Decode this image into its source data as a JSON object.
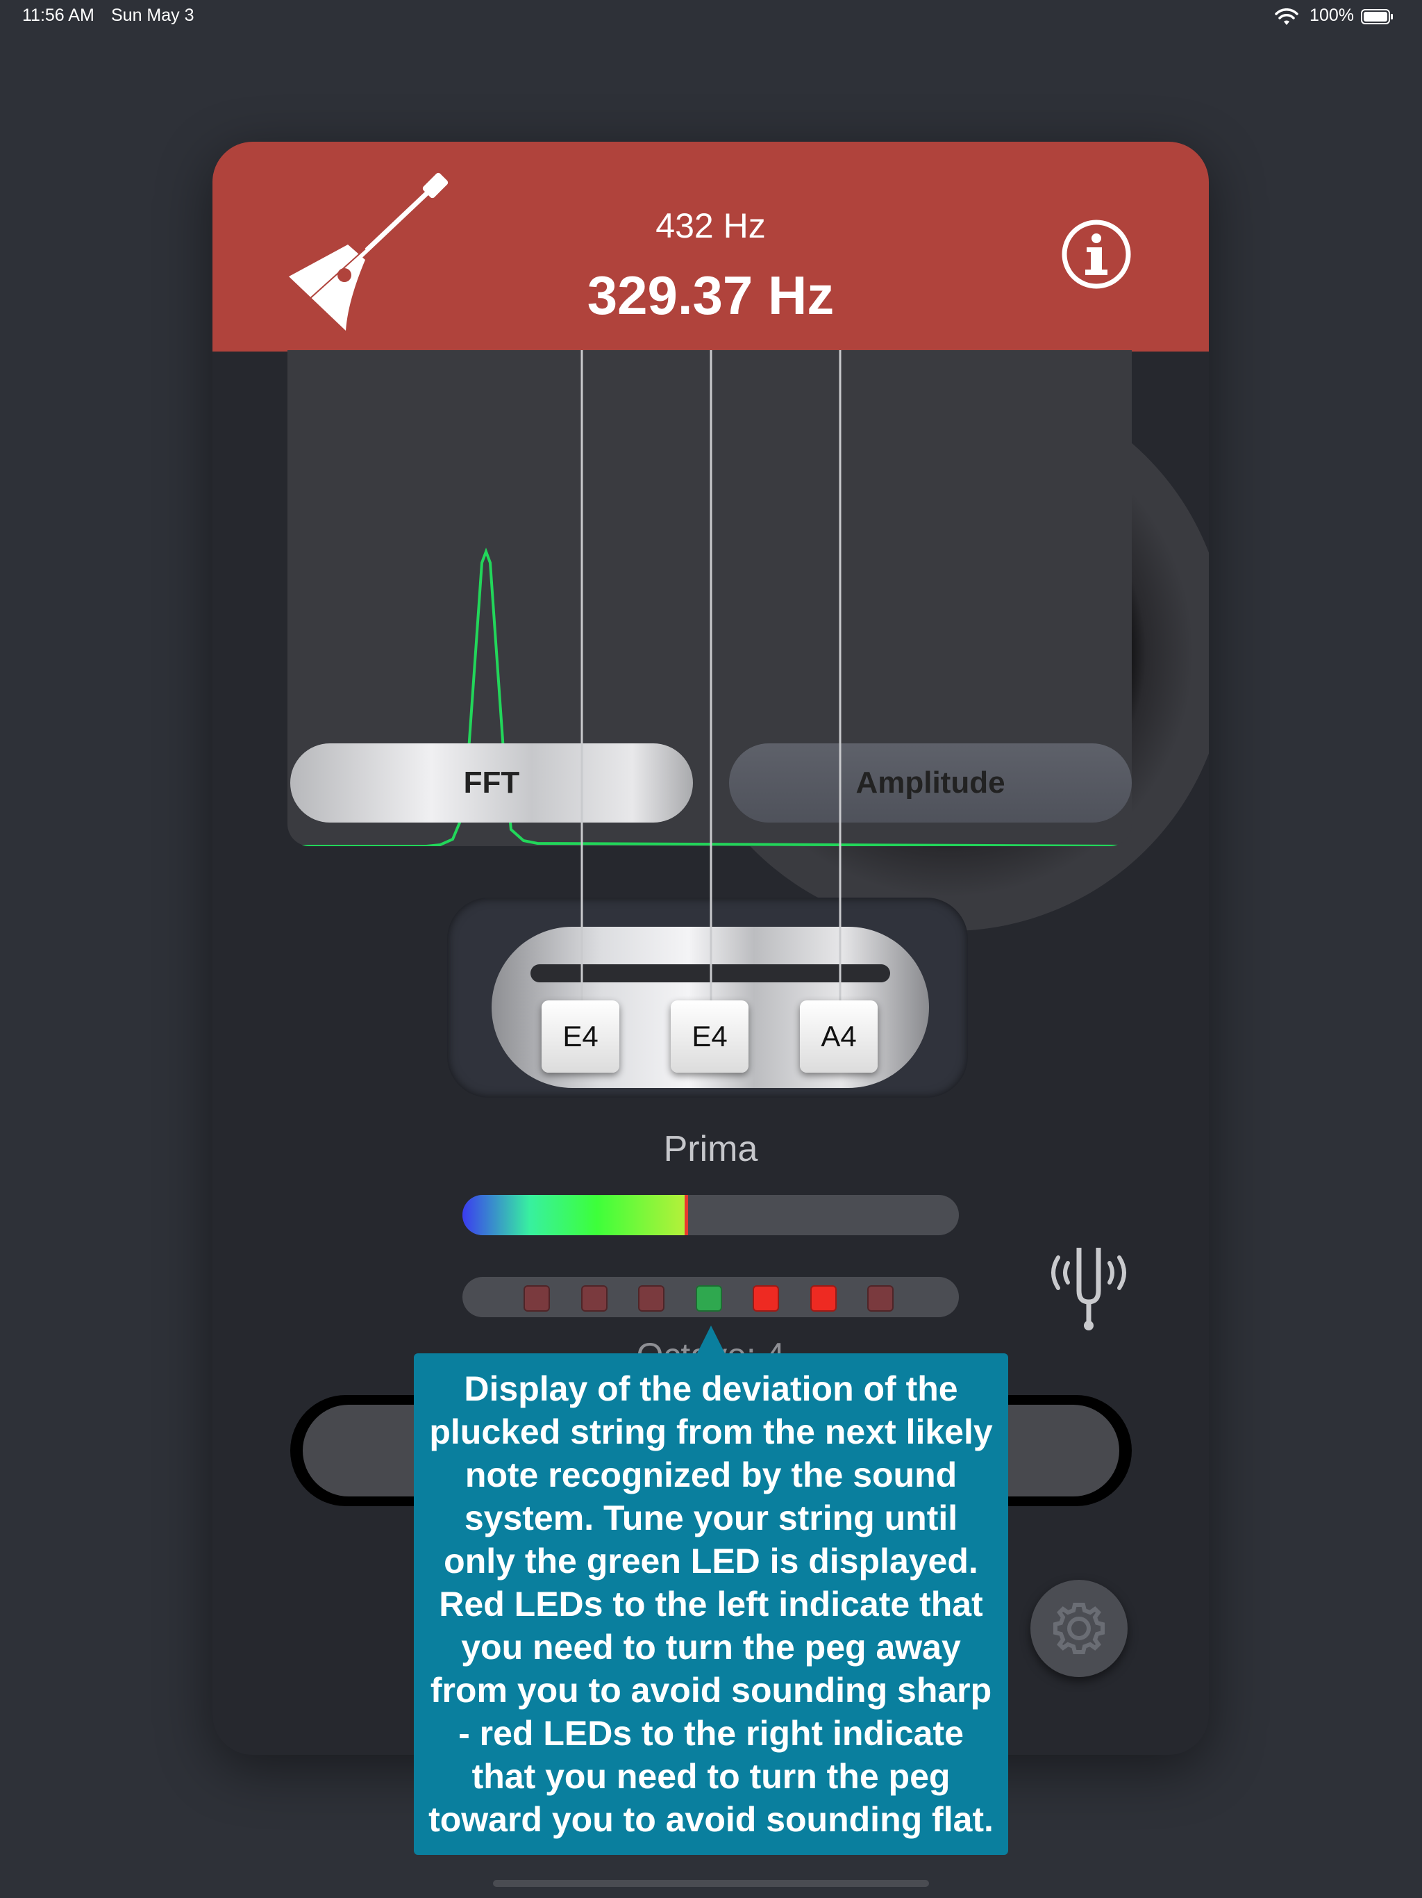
{
  "status_bar": {
    "time": "11:56 AM",
    "date": "Sun May 3",
    "battery": "100%"
  },
  "header": {
    "reference_frequency": "432 Hz",
    "detected_frequency": "329.37 Hz",
    "app_icon": "balalaika-icon",
    "info_icon": "info-icon",
    "background_color": "#b0433c"
  },
  "display_modes": {
    "fft_label": "FFT",
    "amplitude_label": "Amplitude",
    "selected": "FFT"
  },
  "strings": [
    {
      "note": "E4"
    },
    {
      "note": "E4"
    },
    {
      "note": "A4"
    }
  ],
  "preset_label": "Prima",
  "level_meter": {
    "fill_fraction": 0.45
  },
  "deviation_leds": [
    {
      "state": "off-red",
      "color": "#7a3a3e"
    },
    {
      "state": "off-red",
      "color": "#7a3a3e"
    },
    {
      "state": "off-red",
      "color": "#7a3a3e"
    },
    {
      "state": "on-green",
      "color": "#2fa84f"
    },
    {
      "state": "on-red",
      "color": "#ee2a22"
    },
    {
      "state": "on-red",
      "color": "#ee2a22"
    },
    {
      "state": "off-red",
      "color": "#7a3a3e"
    }
  ],
  "octave_label": "Octave: 4",
  "tooltip": {
    "text": "Display of the deviation of the plucked string from the next likely note recognized by the sound system. Tune your string until only the green LED  is displayed. Red LEDs to the left indicate that you need to turn the peg away from you to avoid sounding  sharp - red LEDs to the right indicate that you need to turn the peg toward you to avoid sounding flat.",
    "background_color": "#0a7f9e"
  },
  "icons": {
    "tuning_fork": "tuning-fork-icon",
    "settings": "gear-icon",
    "wifi": "wifi-icon",
    "battery": "battery-icon"
  }
}
